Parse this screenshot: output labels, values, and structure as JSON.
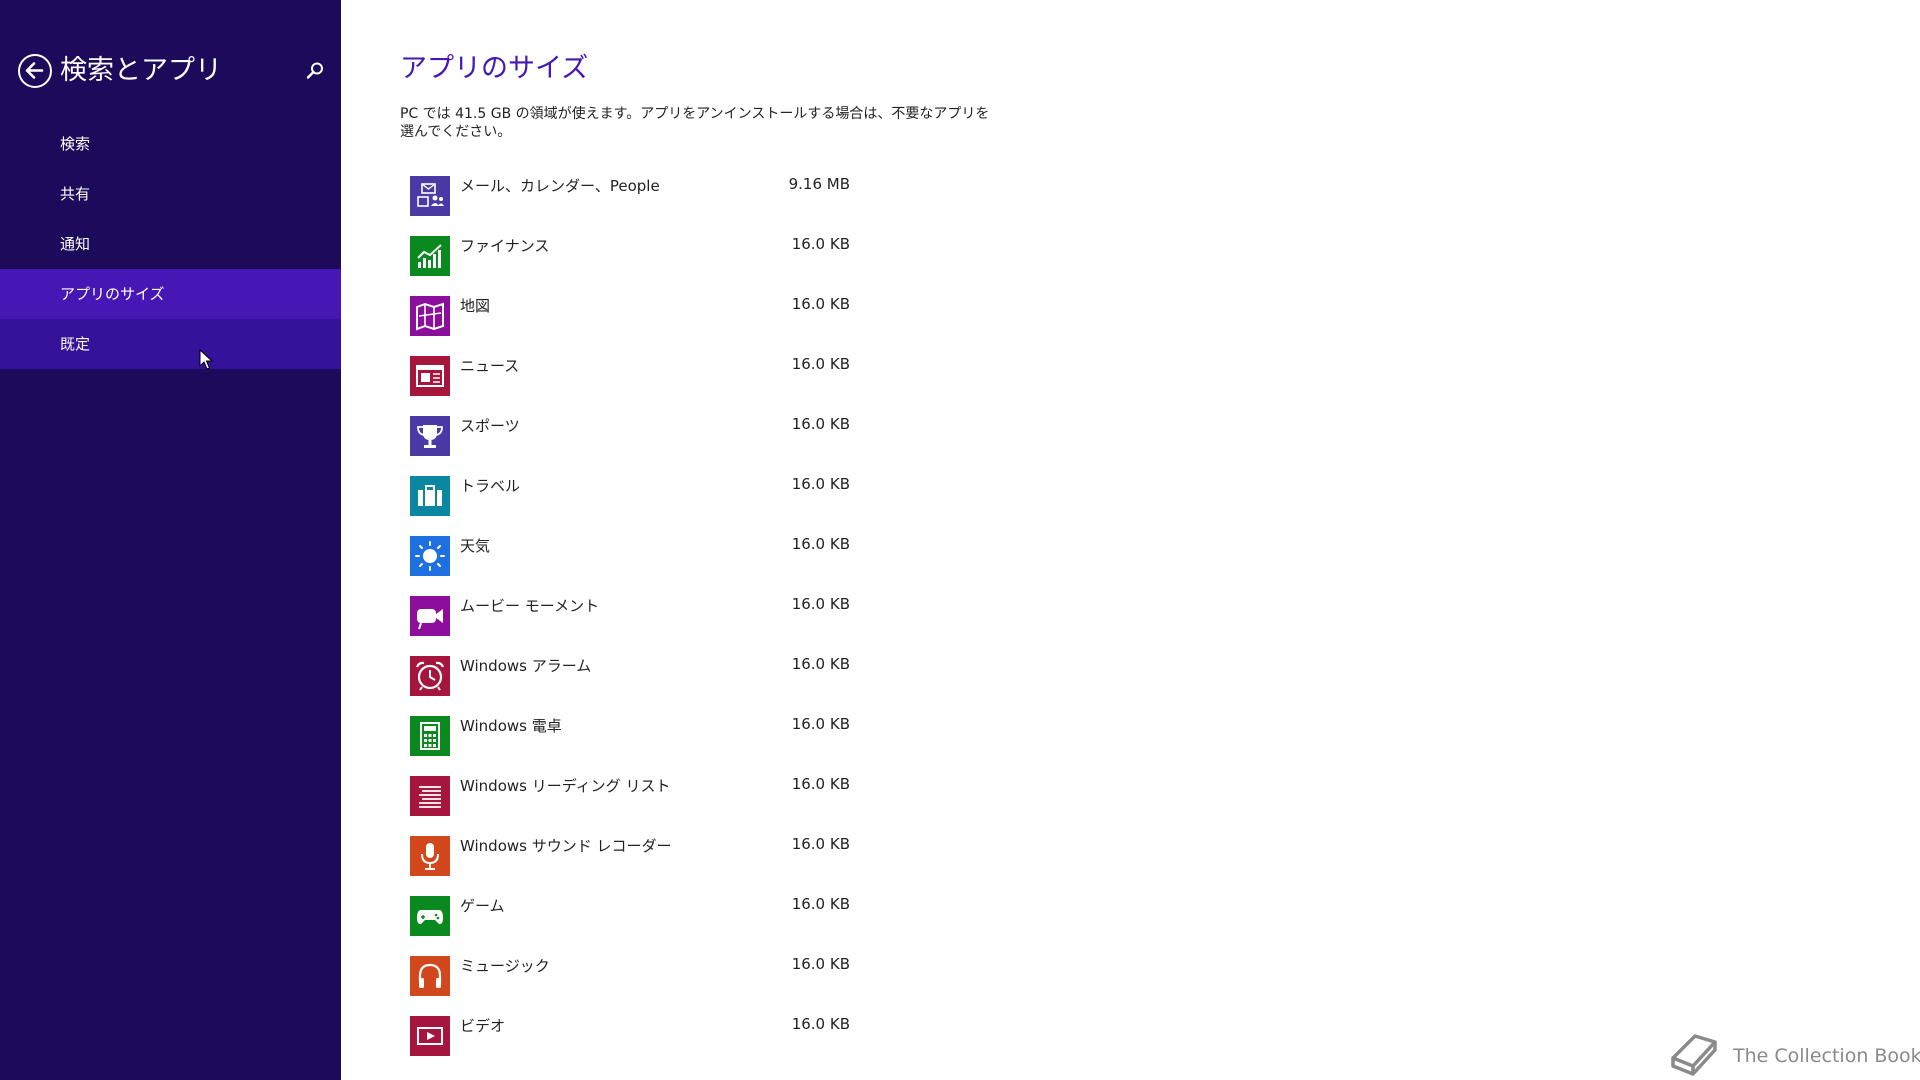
{
  "sidebar": {
    "title": "検索とアプリ",
    "items": [
      {
        "label": "検索"
      },
      {
        "label": "共有"
      },
      {
        "label": "通知"
      },
      {
        "label": "アプリのサイズ"
      },
      {
        "label": "既定"
      }
    ],
    "selected_item": "アプリのサイズ",
    "hovered_item": "既定"
  },
  "main": {
    "title": "アプリのサイズ",
    "description": "PC では 41.5 GB の領域が使えます。アプリをアンインストールする場合は、不要なアプリを選んでください。",
    "apps": [
      {
        "name": "メール、カレンダー、People",
        "size": "9.16 MB",
        "icon": "mail-people-icon",
        "color": "#4b39a6"
      },
      {
        "name": "ファイナンス",
        "size": "16.0 KB",
        "icon": "finance-chart-icon",
        "color": "#0a8a1e"
      },
      {
        "name": "地図",
        "size": "16.0 KB",
        "icon": "map-icon",
        "color": "#8b0f9a"
      },
      {
        "name": "ニュース",
        "size": "16.0 KB",
        "icon": "news-icon",
        "color": "#a6163c"
      },
      {
        "name": "スポーツ",
        "size": "16.0 KB",
        "icon": "trophy-icon",
        "color": "#4b39a6"
      },
      {
        "name": "トラベル",
        "size": "16.0 KB",
        "icon": "suitcase-icon",
        "color": "#0a869e"
      },
      {
        "name": "天気",
        "size": "16.0 KB",
        "icon": "sun-icon",
        "color": "#1e70e0"
      },
      {
        "name": "ムービー モーメント",
        "size": "16.0 KB",
        "icon": "video-camera-icon",
        "color": "#8b0f9a"
      },
      {
        "name": "Windows アラーム",
        "size": "16.0 KB",
        "icon": "alarm-clock-icon",
        "color": "#a6163c"
      },
      {
        "name": "Windows 電卓",
        "size": "16.0 KB",
        "icon": "calculator-icon",
        "color": "#0a8a1e"
      },
      {
        "name": "Windows リーディング リスト",
        "size": "16.0 KB",
        "icon": "reading-list-icon",
        "color": "#a6163c"
      },
      {
        "name": "Windows サウンド レコーダー",
        "size": "16.0 KB",
        "icon": "microphone-icon",
        "color": "#d2471c"
      },
      {
        "name": "ゲーム",
        "size": "16.0 KB",
        "icon": "game-controller-icon",
        "color": "#0a8a1e"
      },
      {
        "name": "ミュージック",
        "size": "16.0 KB",
        "icon": "headphones-icon",
        "color": "#d2471c"
      },
      {
        "name": "ビデオ",
        "size": "16.0 KB",
        "icon": "video-icon",
        "color": "#a6163c"
      }
    ]
  },
  "watermark": {
    "text": "The Collection Book"
  },
  "colors": {
    "sidebar_bg": "#1e0a5b",
    "selected_bg": "#4617b4",
    "accent": "#4617b4"
  }
}
